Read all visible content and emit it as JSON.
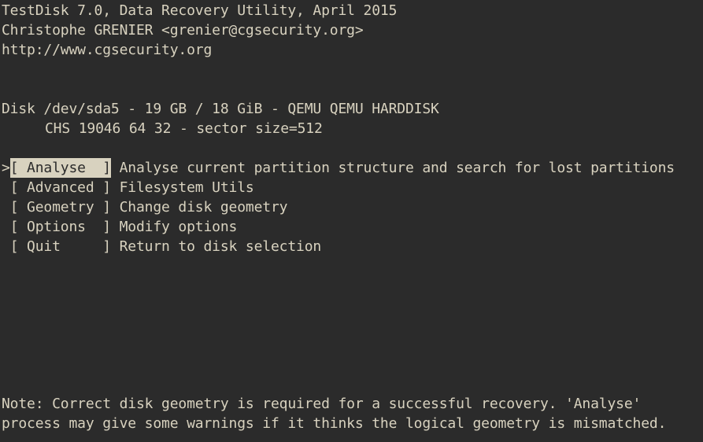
{
  "header": {
    "line1": "TestDisk 7.0, Data Recovery Utility, April 2015",
    "line2": "Christophe GRENIER <grenier@cgsecurity.org>",
    "line3": "http://www.cgsecurity.org"
  },
  "disk": {
    "summary": "Disk /dev/sda5 - 19 GB / 18 GiB - QEMU QEMU HARDDISK",
    "geometry": "CHS 19046 64 32 - sector size=512"
  },
  "menu": {
    "cursor": ">",
    "items": [
      {
        "button": "[ Analyse  ]",
        "description": " Analyse current partition structure and search for lost partitions"
      },
      {
        "button": "[ Advanced ]",
        "description": " Filesystem Utils"
      },
      {
        "button": "[ Geometry ]",
        "description": " Change disk geometry"
      },
      {
        "button": "[ Options  ]",
        "description": " Modify options"
      },
      {
        "button": "[ Quit     ]",
        "description": " Return to disk selection"
      }
    ]
  },
  "note": {
    "line1": "Note: Correct disk geometry is required for a successful recovery. 'Analyse'",
    "line2": "process may give some warnings if it thinks the logical geometry is mismatched."
  }
}
